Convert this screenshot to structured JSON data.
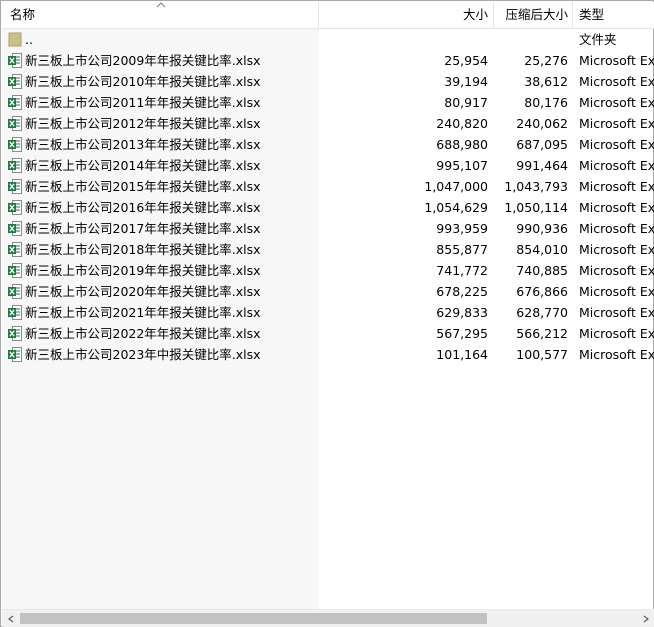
{
  "header": {
    "name_label": "名称",
    "size_label": "大小",
    "compressed_label": "压缩后大小",
    "type_label": "类型"
  },
  "parent_row": {
    "name": "..",
    "type": "文件夹"
  },
  "files": [
    {
      "name": "新三板上市公司2009年年报关键比率.xlsx",
      "size": "25,954",
      "compressed": "25,276",
      "type": "Microsoft Ex"
    },
    {
      "name": "新三板上市公司2010年年报关键比率.xlsx",
      "size": "39,194",
      "compressed": "38,612",
      "type": "Microsoft Ex"
    },
    {
      "name": "新三板上市公司2011年年报关键比率.xlsx",
      "size": "80,917",
      "compressed": "80,176",
      "type": "Microsoft Ex"
    },
    {
      "name": "新三板上市公司2012年年报关键比率.xlsx",
      "size": "240,820",
      "compressed": "240,062",
      "type": "Microsoft Ex"
    },
    {
      "name": "新三板上市公司2013年年报关键比率.xlsx",
      "size": "688,980",
      "compressed": "687,095",
      "type": "Microsoft Ex"
    },
    {
      "name": "新三板上市公司2014年年报关键比率.xlsx",
      "size": "995,107",
      "compressed": "991,464",
      "type": "Microsoft Ex"
    },
    {
      "name": "新三板上市公司2015年年报关键比率.xlsx",
      "size": "1,047,000",
      "compressed": "1,043,793",
      "type": "Microsoft Ex"
    },
    {
      "name": "新三板上市公司2016年年报关键比率.xlsx",
      "size": "1,054,629",
      "compressed": "1,050,114",
      "type": "Microsoft Ex"
    },
    {
      "name": "新三板上市公司2017年年报关键比率.xlsx",
      "size": "993,959",
      "compressed": "990,936",
      "type": "Microsoft Ex"
    },
    {
      "name": "新三板上市公司2018年年报关键比率.xlsx",
      "size": "855,877",
      "compressed": "854,010",
      "type": "Microsoft Ex"
    },
    {
      "name": "新三板上市公司2019年年报关键比率.xlsx",
      "size": "741,772",
      "compressed": "740,885",
      "type": "Microsoft Ex"
    },
    {
      "name": "新三板上市公司2020年年报关键比率.xlsx",
      "size": "678,225",
      "compressed": "676,866",
      "type": "Microsoft Ex"
    },
    {
      "name": "新三板上市公司2021年年报关键比率.xlsx",
      "size": "629,833",
      "compressed": "628,770",
      "type": "Microsoft Ex"
    },
    {
      "name": "新三板上市公司2022年年报关键比率.xlsx",
      "size": "567,295",
      "compressed": "566,212",
      "type": "Microsoft Ex"
    },
    {
      "name": "新三板上市公司2023年中报关键比率.xlsx",
      "size": "101,164",
      "compressed": "100,577",
      "type": "Microsoft Ex"
    }
  ],
  "icons": {
    "file": "excel-file-icon",
    "parent": "folder-up-icon",
    "sort": "sort-ascending-icon",
    "scroll_left": "scroll-left-arrow-icon",
    "scroll_right": "scroll-right-arrow-icon"
  },
  "colors": {
    "excel_green": "#1f7a45",
    "folder": "#c9c18a",
    "name_column_bg": "#f7f7f7",
    "scroll_thumb": "#c2c2c2"
  }
}
